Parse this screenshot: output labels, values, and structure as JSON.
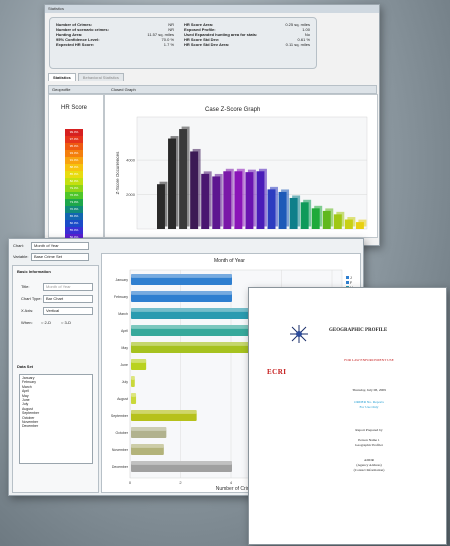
{
  "w1": {
    "title": "Statistics",
    "summary": {
      "left": [
        [
          "Number of Crimes:",
          "NR"
        ],
        [
          "Number of scenario crimes:",
          "NR"
        ],
        [
          "Hunting Area:",
          "11.57 sq. miles"
        ],
        [
          "95% Confidence Level:",
          "70.0 %"
        ],
        [
          "Expected HR Score:",
          "1.7 %"
        ]
      ],
      "right": [
        [
          "HR Score Area:",
          "0.25 sq. miles"
        ],
        [
          "Exposed Profile:",
          "1.00"
        ],
        [
          "Used Expanded hunting area for stats:",
          "No"
        ],
        [
          "HR Score Std Dev:",
          "0.61 %"
        ],
        [
          "HR Score Std Dev Area:",
          "0.11 sq. miles"
        ]
      ]
    },
    "tabs": [
      "Statistics",
      "Behavioral Statistics"
    ],
    "panel_headers": [
      "Geoprofile",
      "Closed Graph"
    ],
    "legend_title": "HR Score",
    "legend_colors": [
      "#d62020",
      "#e5341c",
      "#ee5a12",
      "#f47f0d",
      "#f8a310",
      "#f7c30f",
      "#e8dc10",
      "#c4e010",
      "#8fd418",
      "#4fc62a",
      "#1ea74a",
      "#128a7a",
      "#1266b0",
      "#1a4bc8",
      "#3a2fd4",
      "#5a1fd0",
      "#7418c0",
      "#8a14b0",
      "#a012a0",
      "#6a0c80"
    ],
    "legend_labels": [
      "99.0%",
      "97.0%",
      "95.0%",
      "93.0%",
      "91.0%",
      "88.0%",
      "85.0%",
      "82.0%",
      "79.0%",
      "76.0%",
      "73.0%",
      "70.0%",
      "65.0%",
      "60.0%",
      "55.0%",
      "50.0%",
      "45.0%",
      "40.0%",
      "30.0%",
      "20.0%"
    ],
    "status_tabs": [
      "Case Details",
      "Base Crime Set",
      "Linkage Analysis",
      "Base Suspect Set",
      "Google Maps",
      "Case Temporal Analysis"
    ]
  },
  "chart_data": [
    {
      "type": "bar",
      "title": "Case Z-Score Graph",
      "ylabel": "Z-Score Occurrences",
      "xlabel": "",
      "ylim": [
        0,
        6500
      ],
      "yticks": [
        2000,
        4000
      ],
      "values": [
        2600,
        5250,
        5800,
        4500,
        3200,
        3050,
        3350,
        3350,
        3300,
        3350,
        2300,
        2150,
        1800,
        1550,
        1200,
        1050,
        850,
        550,
        400
      ],
      "colors": [
        "#2a2a2a",
        "#2a2a2a",
        "#3a3a3a",
        "#3c1a55",
        "#4a1670",
        "#5d1690",
        "#7a18a8",
        "#8a14b8",
        "#6a14b0",
        "#4a1cb8",
        "#2c3cc0",
        "#1e5ab8",
        "#0f7f8a",
        "#0f9a5a",
        "#1eaa3a",
        "#60b81e",
        "#a0c814",
        "#c8d012",
        "#e8d010"
      ]
    },
    {
      "type": "bar",
      "orientation": "horizontal",
      "title": "Month of Year",
      "xlabel": "Number of Crimes",
      "categories": [
        "January",
        "February",
        "March",
        "April",
        "May",
        "June",
        "July",
        "August",
        "September",
        "October",
        "November",
        "December"
      ],
      "values": [
        4,
        4,
        8.5,
        8.4,
        6,
        0.6,
        0.15,
        0.2,
        2.6,
        1.4,
        1.3,
        4
      ],
      "colors": [
        "#2f7fd0",
        "#2f7fd0",
        "#2a9bb0",
        "#37a99b",
        "#a6c21f",
        "#b9d21f",
        "#c9d83a",
        "#c9d83a",
        "#b6c11b",
        "#b1b28e",
        "#b3b37a",
        "#a0a0a0"
      ],
      "xticks": [
        "0",
        "2",
        "4",
        "6",
        "8"
      ]
    }
  ],
  "w2": {
    "chart_label": "Chart:",
    "chart_value": "Month of Year",
    "variable_label": "Variable:",
    "variable_value": "Base Crime Set",
    "basic_info": "Basic Information",
    "title_label": "Title:",
    "title_value": "Month of Year",
    "chart_type_label": "Chart Type:",
    "chart_type_value": "Bar Chart",
    "xaxis_label": "X Axis:",
    "xaxis_value": "Vertical",
    "when_label": "When:",
    "radio1": "2-D",
    "radio2": "3-D",
    "data_set": "Data Set",
    "months": [
      "January",
      "February",
      "March",
      "April",
      "May",
      "June",
      "July",
      "August",
      "September",
      "October",
      "November",
      "December"
    ],
    "legend_items": [
      "J",
      "F",
      "M",
      "A"
    ]
  },
  "w3": {
    "title": "GEOGRAPHIC PROFILE",
    "ecri": "ECRI",
    "subtitle": "FOR LAW ENFORCEMENT USE",
    "date": "Thursday, July 08, 2009",
    "line1": "ORDER No. Reports",
    "line2": "For Use Only",
    "prepared": "Report Prepared by",
    "name": "Person Name 1",
    "role": "Geographic Profiler",
    "addr1": "ADDR",
    "addr2": "(Agency Address)",
    "addr3": "(Contact Information)"
  }
}
